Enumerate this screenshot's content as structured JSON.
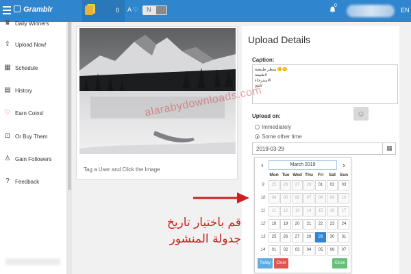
{
  "header": {
    "app_name": "Gramblr",
    "coins": "0",
    "user_icon_text": "A ♡",
    "toggle_text": "N",
    "notification_count": "0",
    "language": "EN"
  },
  "sidebar": {
    "items": [
      {
        "label": "Daily Winners",
        "icon": "trophy-icon"
      },
      {
        "label": "Upload Now!",
        "icon": "upload-icon"
      },
      {
        "label": "Schedule",
        "icon": "calendar-icon"
      },
      {
        "label": "History",
        "icon": "history-icon"
      },
      {
        "label": "Earn Coins!",
        "icon": "heart-icon"
      },
      {
        "label": "Or Buy Them",
        "icon": "cart-icon"
      },
      {
        "label": "Gain Followers",
        "icon": "user-icon"
      },
      {
        "label": "Feedback",
        "icon": "help-icon"
      }
    ]
  },
  "photo": {
    "tag_hint": "Tag a User and Click the Image"
  },
  "upload": {
    "title": "Upload Details",
    "caption_label": "Caption:",
    "caption_lines": [
      "😊🌼 منظر طبيعية",
      "#طبيعة",
      "#استرخاء",
      "#ثلج"
    ],
    "upload_on_label": "Upload on:",
    "options": [
      {
        "label": "Immediately",
        "selected": false
      },
      {
        "label": "Some other time",
        "selected": true
      }
    ],
    "date_value": "2019-03-29"
  },
  "calendar": {
    "month": "March 2019",
    "prev": "‹",
    "next": "›",
    "dow": [
      "Mon",
      "Tue",
      "Wed",
      "Thu",
      "Fri",
      "Sat",
      "Sun"
    ],
    "weeks": [
      {
        "num": "9",
        "days": [
          "25",
          "26",
          "27",
          "28",
          "01",
          "02",
          "03"
        ],
        "dim": [
          true,
          true,
          true,
          true,
          false,
          false,
          false
        ]
      },
      {
        "num": "10",
        "days": [
          "04",
          "05",
          "06",
          "07",
          "08",
          "09",
          "10"
        ],
        "dim": [
          true,
          true,
          true,
          true,
          true,
          true,
          true
        ]
      },
      {
        "num": "11",
        "days": [
          "11",
          "12",
          "13",
          "14",
          "15",
          "16",
          "17"
        ],
        "dim": [
          true,
          true,
          true,
          true,
          true,
          true,
          true
        ]
      },
      {
        "num": "12",
        "days": [
          "18",
          "19",
          "20",
          "21",
          "22",
          "23",
          "24"
        ],
        "dim": [
          false,
          false,
          false,
          false,
          false,
          false,
          false
        ]
      },
      {
        "num": "13",
        "days": [
          "25",
          "26",
          "27",
          "28",
          "29",
          "30",
          "31"
        ],
        "dim": [
          false,
          false,
          false,
          false,
          false,
          false,
          false
        ]
      },
      {
        "num": "14",
        "days": [
          "01",
          "02",
          "03",
          "04",
          "05",
          "06",
          "07"
        ],
        "dim": [
          false,
          false,
          false,
          false,
          false,
          false,
          false
        ]
      }
    ],
    "selected_day": "29",
    "today_label": "Today",
    "clear_label": "Clear",
    "close_label": "Close"
  },
  "watermark": "alarabydownloads.com",
  "annotation": {
    "line1": "قم باختيار تاريخ",
    "line2": "جدولة المنشور"
  },
  "colors": {
    "header_blue": "#2f86cf",
    "arrow_red": "#cc2020",
    "selected_day": "#2f86cf"
  }
}
